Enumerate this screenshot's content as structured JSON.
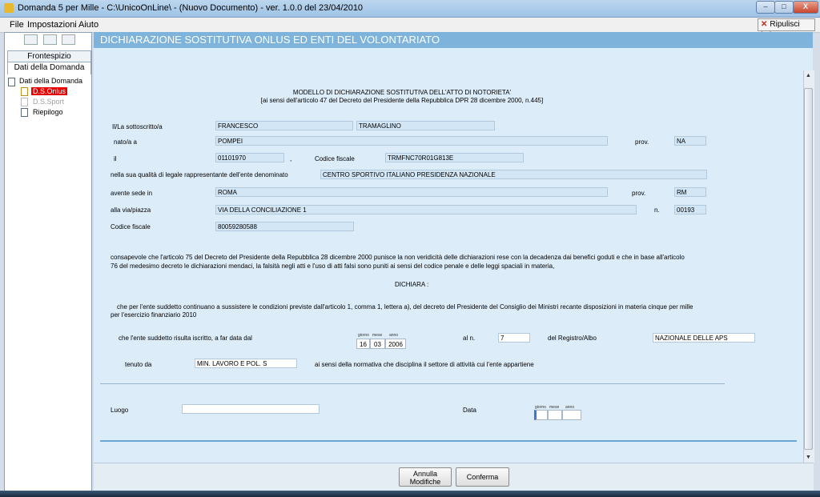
{
  "window": {
    "title": "Domanda 5 per Mille - C:\\UnicoOnLine\\ - (Nuovo Documento)  -  ver. 1.0.0 del 23/04/2010",
    "minimize": "–",
    "maximize": "□",
    "close": "X"
  },
  "menu": {
    "file": "File",
    "impostazioni": "Impostazioni",
    "aiuto": "Aiuto",
    "ripulisci": "Ripulisci dati"
  },
  "left": {
    "tab_frontespizio": "Frontespizio",
    "tab_dati": "Dati della Domanda",
    "tree_root": "Dati della Domanda",
    "tree_onlus": "D.S.Onlus",
    "tree_sport": "D.S.Sport",
    "tree_riepilogo": "Riepilogo"
  },
  "header": {
    "title": "DICHIARAZIONE SOSTITUTIVA ONLUS ED ENTI DEL VOLONTARIATO"
  },
  "form": {
    "heading1": "MODELLO DI DICHIARAZIONE SOSTITUTIVA DELL'ATTO DI NOTORIETA'",
    "heading2": "[ai sensi dell'articolo 47 del Decreto del Presidente della Repubblica DPR 28 dicembre 2000, n.445]",
    "label_sottoscritto": "Il/La sottoscritto/a",
    "nome": "FRANCESCO",
    "cognome": "TRAMAGLINO",
    "label_nato": "nato/a a",
    "luogo_nascita": "POMPEI",
    "label_prov": "prov.",
    "prov_nascita": "NA",
    "label_il": "il",
    "data_nascita": "01101970",
    "comma": ",",
    "label_cf": "Codice fiscale",
    "codice_fiscale": "TRMFNC70R01G813E",
    "label_qualita": "nella sua qualità di legale rappresentante dell'ente denominato",
    "ente": "CENTRO SPORTIVO ITALIANO PRESIDENZA NAZIONALE",
    "label_sede": "avente sede in",
    "sede": "ROMA",
    "label_prov2": "prov.",
    "prov_sede": "RM",
    "label_via": "alla via/piazza",
    "via": "VIA DELLA CONCILIAZIONE 1",
    "label_n": "n.",
    "cap": "00193",
    "label_cf_ente": "Codice fiscale",
    "cf_ente": "80059280588",
    "consapevole_1": "consapevole che l'articolo 75 del Decreto del Presidente della Repubblica 28 dicembre 2000 punisce la non veridicità delle dichiarazioni rese con la decadenza dai benefici goduti e che in base all'articolo",
    "consapevole_2": "76 del medesimo decreto le dichiarazioni mendaci, la falsità negli atti e l'uso di atti falsi sono puniti ai sensi del codice penale e delle leggi spaciali in materia,",
    "dichiara": "DICHIARA :",
    "che_1": "che per l'ente suddetto continuano a sussistere le condizioni  previste dall'articolo 1, comma 1, lettera a), del decreto del Presidente del Consiglio dei Ministri recante disposizioni in materia cinque per mille",
    "che_2": "per l'esercizio finanziario 2010",
    "label_iscritto": "che l'ente suddetto risulta iscritto, a far data dal",
    "date_hdr_giorno": "giorno",
    "date_hdr_mese": "mese",
    "date_hdr_anno": "anno",
    "iscr_giorno": "16",
    "iscr_mese": "03",
    "iscr_anno": "2006",
    "label_al_n": "al n.",
    "numero_registro": "7",
    "label_registro": "del Registro/Albo",
    "registro": "NAZIONALE DELLE APS",
    "label_tenuto": "tenuto da",
    "tenuto_da": "MIN. LAVORO E POL. S",
    "label_normativa": "ai sensi della normativa che disciplina il settore di attività cui l'ente appartiene",
    "label_luogo": "Luogo",
    "luogo": "",
    "label_data": "Data",
    "data_giorno": "",
    "data_mese": "",
    "data_anno": ""
  },
  "buttons": {
    "annulla_1": "Annulla",
    "annulla_2": "Modifiche",
    "conferma": "Conferma"
  }
}
